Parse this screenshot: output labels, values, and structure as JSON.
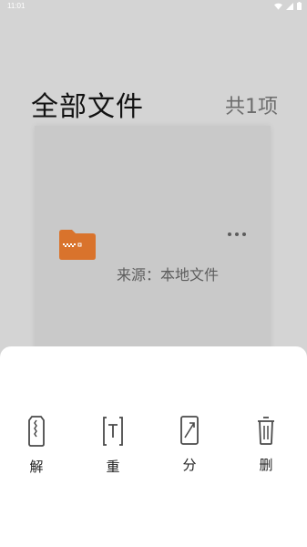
{
  "status_bar": {
    "time": "11:01",
    "icons": [
      "wifi-icon",
      "signal-icon",
      "battery-icon"
    ]
  },
  "header": {
    "title": "全部文件",
    "count": "共1项"
  },
  "file_item": {
    "icon": "zip-folder-icon",
    "source": "来源：本地文件",
    "folder_color": "#d9732c"
  },
  "actions": [
    {
      "icon": "zip-file-icon",
      "label": "解"
    },
    {
      "icon": "rename-icon",
      "label": "重"
    },
    {
      "icon": "share-icon",
      "label": "分"
    },
    {
      "icon": "trash-icon",
      "label": "删"
    }
  ]
}
